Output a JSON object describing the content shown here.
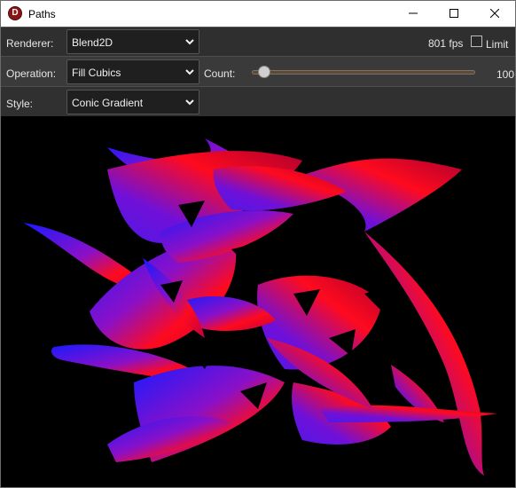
{
  "window": {
    "title": "Paths",
    "app_icon_letter": "D"
  },
  "controls": {
    "renderer": {
      "label": "Renderer:",
      "value": "Blend2D"
    },
    "fps": "801 fps",
    "limit_label": "Limit",
    "limit_checked": false,
    "operation": {
      "label": "Operation:",
      "value": "Fill Cubics"
    },
    "count": {
      "label": "Count:",
      "value": "100",
      "slider_fraction": 0.03
    },
    "style": {
      "label": "Style:",
      "value": "Conic Gradient"
    }
  },
  "icons": {
    "app": "blend2d-logo-icon",
    "minimize": "minimize-icon",
    "maximize": "maximize-icon",
    "close": "close-icon",
    "dropdown": "chevron-down-icon"
  },
  "colors": {
    "gradient_blue": "#1a1aff",
    "gradient_purple": "#8a10c8",
    "gradient_red": "#ff0a1e",
    "gradient_dark_red": "#b00030"
  }
}
